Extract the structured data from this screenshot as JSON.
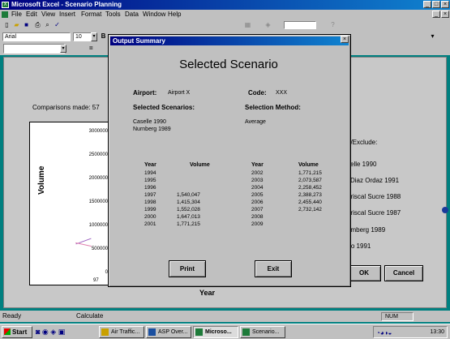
{
  "window": {
    "title": "Microsoft Excel - Scenario Planning",
    "minimize": "_",
    "maximize": "□",
    "close": "×"
  },
  "menu": [
    "File",
    "Edit",
    "View",
    "Insert",
    "Format",
    "Tools",
    "Data",
    "Window",
    "Help"
  ],
  "toolbar": {
    "font_name": "Arial",
    "font_size": "10"
  },
  "sheet": {
    "comparisons_label": "Comparisons made: 57",
    "chart": {
      "y_ticks": [
        "3000000",
        "2500000",
        "2000000",
        "1500000",
        "1000000",
        "500000",
        "0"
      ],
      "y_label": "Volume",
      "x_first": "97",
      "x_label": "Year"
    },
    "right_panel": {
      "heading": "e/Exclude:",
      "items": [
        "selle 1990",
        "Diaz Ordaz 1991",
        "ariscal Sucre 1988",
        "ariscal Sucre 1987",
        "umberg 1989",
        "rto 1991"
      ]
    },
    "ok_label": "OK",
    "cancel_label": "Cancel"
  },
  "dialog": {
    "title": "Output Summary",
    "close": "×",
    "heading": "Selected Scenario",
    "airport_label": "Airport:",
    "airport_value": "Airport X",
    "code_label": "Code:",
    "code_value": "XXX",
    "scenarios_label": "Selected Scenarios:",
    "scenarios": [
      "Caselle 1990",
      "Nurnberg 1989"
    ],
    "method_label": "Selection Method:",
    "method_value": "Average",
    "table_headers": [
      "Year",
      "Volume",
      "Year",
      "Volume"
    ],
    "left_rows": [
      [
        "1994",
        ""
      ],
      [
        "1995",
        ""
      ],
      [
        "1996",
        ""
      ],
      [
        "1997",
        "1,540,047"
      ],
      [
        "1998",
        "1,415,304"
      ],
      [
        "1999",
        "1,552,028"
      ],
      [
        "2000",
        "1,647,013"
      ],
      [
        "2001",
        "1,771,215"
      ]
    ],
    "right_rows": [
      [
        "2002",
        "1,771,215"
      ],
      [
        "2003",
        "2,073,587"
      ],
      [
        "2004",
        "2,258,452"
      ],
      [
        "2005",
        "2,388,273"
      ],
      [
        "2006",
        "2,455,440"
      ],
      [
        "2007",
        "2,732,142"
      ],
      [
        "2008",
        ""
      ],
      [
        "2009",
        ""
      ]
    ],
    "print_label": "Print",
    "exit_label": "Exit"
  },
  "status": {
    "ready": "Ready",
    "calculate": "Calculate",
    "num": "NUM"
  },
  "taskbar": {
    "start": "Start",
    "tasks": [
      "Air Traffic...",
      "ASP Over...",
      "Microso...",
      "Scenario..."
    ],
    "clock": "13:30"
  }
}
